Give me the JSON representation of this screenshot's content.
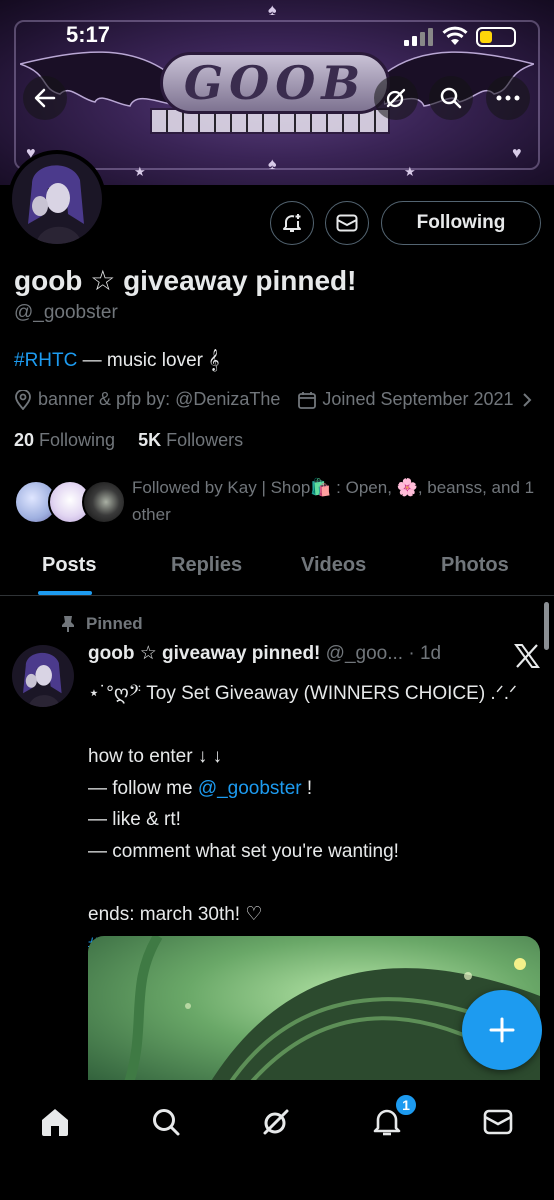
{
  "status_bar": {
    "time": "5:17"
  },
  "banner": {
    "logo_text": "GOOB"
  },
  "profile": {
    "display_name": "goob ☆ giveaway pinned!",
    "handle": "@_goobster",
    "bio_hashtag": "#RHTC",
    "bio_text": " — music lover 𝄞",
    "location": "banner & pfp by: @DenizaThe",
    "joined": "Joined September 2021",
    "following_count": "20",
    "following_label": " Following",
    "followers_count": "5K",
    "followers_label": " Followers",
    "followed_by": "Followed by Kay | Shop🛍️ : Open, 🌸, beanss, and 1 other",
    "following_button": "Following"
  },
  "tabs": [
    {
      "label": "Posts",
      "active": true
    },
    {
      "label": "Replies",
      "active": false
    },
    {
      "label": "Videos",
      "active": false
    },
    {
      "label": "Photos",
      "active": false
    }
  ],
  "tweet": {
    "pinned_label": "Pinned",
    "author_name": "goob ☆ giveaway pinned!",
    "author_handle": "@_goo...",
    "time": "· 1d",
    "line1": "⋆˙°ღ𝄢 Toy Set Giveaway (WINNERS CHOICE) .ᐟ.ᐟ",
    "line2": "how to enter ↓ ↓",
    "line3_prefix": "— follow me ",
    "line3_mention": "@_goobster",
    "line3_suffix": " !",
    "line4": "— like & rt!",
    "line5": "— comment what set you're wanting!",
    "line6": "ends: march 30th! ♡",
    "hashtags": "#RoyaleHighGiveaway #RoyaleHigh"
  },
  "bottom_nav": {
    "notification_count": "1"
  },
  "colors": {
    "accent": "#1d9bf0",
    "muted": "#71767b",
    "text": "#e7e9ea",
    "border": "#2f3336"
  }
}
